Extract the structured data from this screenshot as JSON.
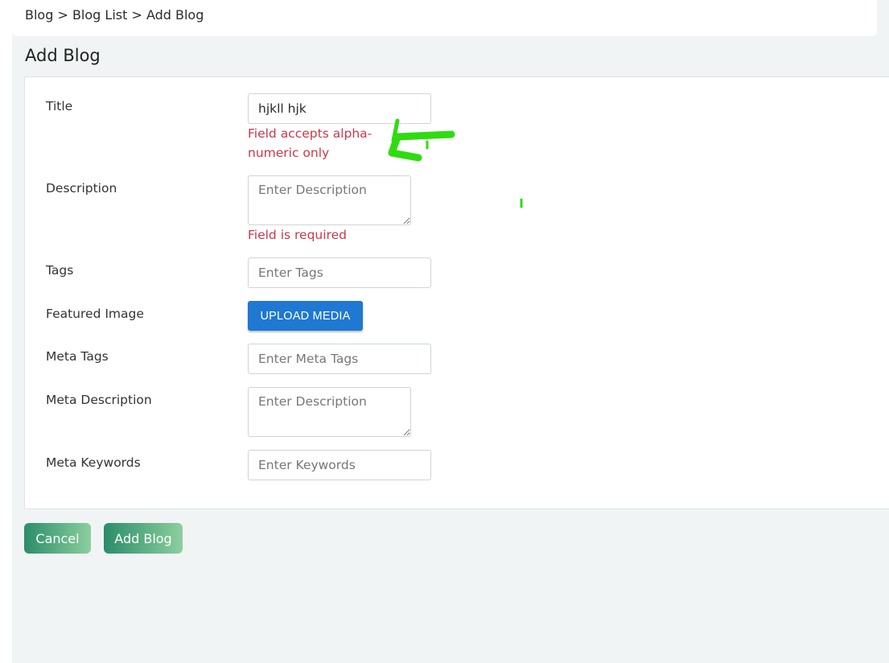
{
  "breadcrumb": {
    "text": "Blog > Blog List > Add Blog"
  },
  "page": {
    "title": "Add Blog"
  },
  "form": {
    "title": {
      "label": "Title",
      "value": "hjkll hjk",
      "error_line1": "Field accepts alpha-",
      "error_line2": "numeric only"
    },
    "description": {
      "label": "Description",
      "placeholder": "Enter Description",
      "error": "Field is required"
    },
    "tags": {
      "label": "Tags",
      "placeholder": "Enter Tags"
    },
    "featured_image": {
      "label": "Featured Image",
      "button_label": "UPLOAD MEDIA"
    },
    "meta_tags": {
      "label": "Meta Tags",
      "placeholder": "Enter Meta Tags"
    },
    "meta_description": {
      "label": "Meta Description",
      "placeholder": "Enter Description"
    },
    "meta_keywords": {
      "label": "Meta Keywords",
      "placeholder": "Enter Keywords"
    }
  },
  "actions": {
    "cancel_label": "Cancel",
    "submit_label": "Add Blog"
  },
  "colors": {
    "error": "#c9384a",
    "primary": "#1f78d1",
    "gradient_start": "#2b8d6a",
    "gradient_end": "#8ccf9e",
    "annotation": "#2fdc10"
  }
}
